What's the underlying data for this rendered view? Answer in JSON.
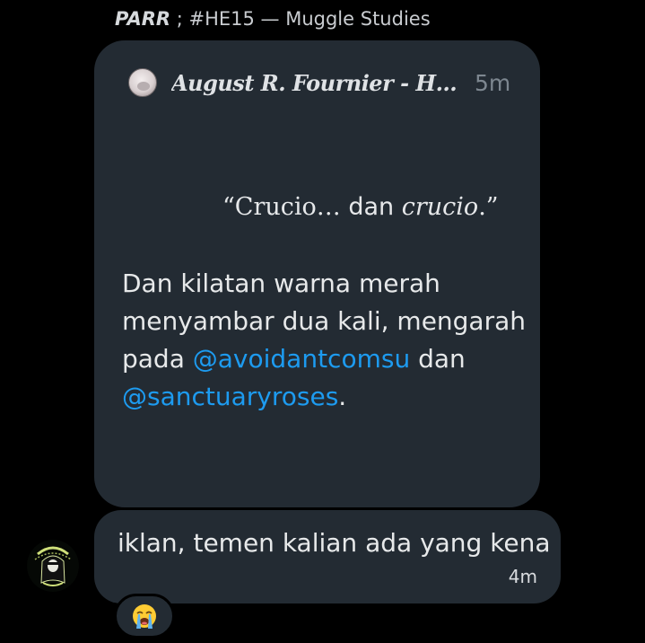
{
  "reply_header": {
    "sender": "PARR",
    "rest": " ; #HE15 — Muggle Studies"
  },
  "quoted_post": {
    "author": "August R. Fournier - HE…",
    "time": "5m",
    "quote": {
      "open": "“Crucio…",
      "middle": " dan ",
      "italic": "crucio",
      "close": ".”"
    },
    "body_text": "Dan kilatan warna merah menyambar dua kali, mengarah pada ",
    "mention_1": "@avoidantcomsu",
    "connector": " dan ",
    "mention_2": "@sanctuaryroses",
    "end": "."
  },
  "message": {
    "text": "iklan, temen kalian ada yang kena",
    "time": "4m"
  },
  "reaction": {
    "emoji": "loudly-crying-face"
  },
  "colors": {
    "background": "#000000",
    "bubble": "#232b33",
    "mention": "#1d9bf0",
    "muted": "#7d8790"
  }
}
